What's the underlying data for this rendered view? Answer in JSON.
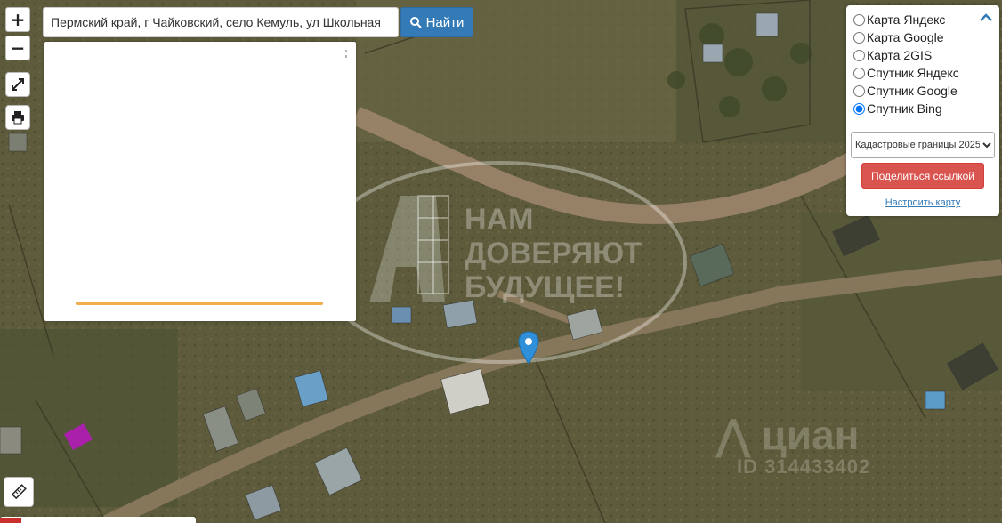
{
  "search": {
    "value": "Пермский край, г Чайковский, село Кемуль, ул Школьная",
    "button_label": "Найти"
  },
  "zoom": {
    "in_label": "+",
    "out_label": "−"
  },
  "layers": {
    "options": [
      {
        "label": "Карта Яндекс",
        "selected": false
      },
      {
        "label": "Карта Google",
        "selected": false
      },
      {
        "label": "Карта 2GIS",
        "selected": false
      },
      {
        "label": "Спутник Яндекс",
        "selected": false
      },
      {
        "label": "Спутник Google",
        "selected": false
      },
      {
        "label": "Спутник Bing",
        "selected": true
      }
    ],
    "cadastral_select": "Кадастровые границы 2025",
    "share_label": "Поделиться ссылкой",
    "configure_label": "Настроить карту"
  },
  "info_panel": {
    "progress": 1.0,
    "progress_color": "#f0ad4e"
  },
  "watermarks": {
    "slogan_line1": "НАМ",
    "slogan_line2": "ДОВЕРЯЮТ",
    "slogan_line3": "БУДУЩЕЕ!",
    "cian_logo": "циан",
    "cian_id": "ID 314433402"
  },
  "icons": {
    "search": "search-icon",
    "fullscreen": "expand-icon",
    "print": "printer-icon",
    "ruler": "ruler-icon",
    "collapse": "chevron-up-icon",
    "marker": "map-pin-icon"
  },
  "colors": {
    "primary": "#337ab7",
    "danger": "#d9534f",
    "marker": "#2f8fd8",
    "parcel_highlight": "#b31cb8"
  }
}
